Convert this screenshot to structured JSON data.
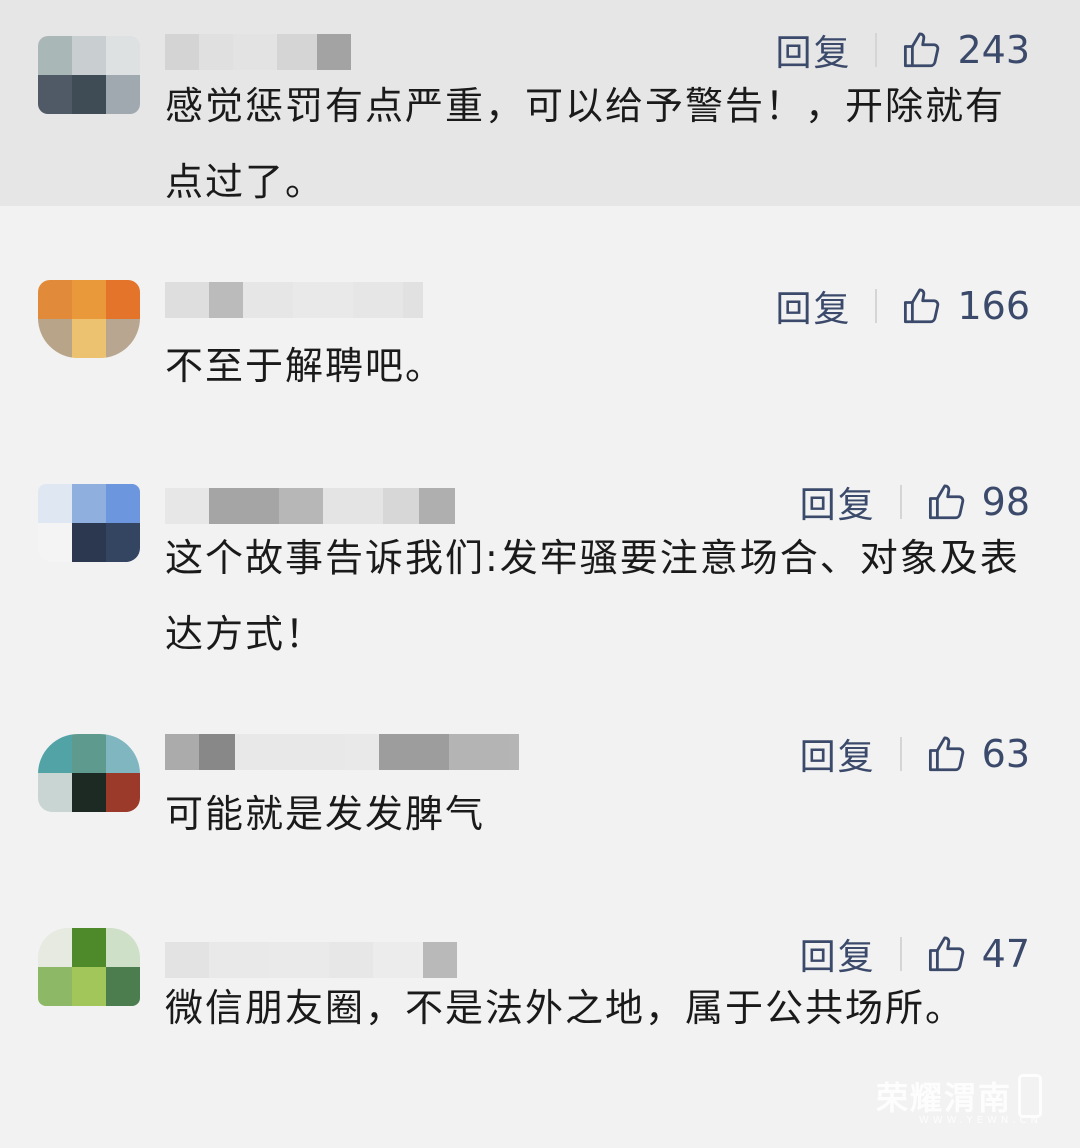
{
  "comments": [
    {
      "reply_label": "回复",
      "likes": "243",
      "text": "感觉惩罚有点严重，可以给予警告！，开除就有点过了。",
      "avatar_colors": [
        "#a9b8b6",
        "#c9cfd0",
        "#dde1e2",
        "#4f5a66",
        "#3f4b55",
        "#a1a9b0"
      ],
      "name_blocks": [
        "#cfcfcf",
        "#dedede",
        "#e3e3e3",
        "#d0d0d0",
        "#8d8d8d",
        "#e6e6e6"
      ]
    },
    {
      "reply_label": "回复",
      "likes": "166",
      "text": "不至于解聘吧。",
      "avatar_colors": [
        "#e08a3a",
        "#e9983a",
        "#e3742a",
        "#b8a489",
        "#ecc16f",
        "#b8a690"
      ],
      "name_blocks": [
        "#d8d8d8",
        "#a9a9a9",
        "#e3e3e3",
        "#e6e6e6",
        "#e2e2e2",
        "#dcdcdc"
      ]
    },
    {
      "reply_label": "回复",
      "likes": "98",
      "text": "这个故事告诉我们:发牢骚要注意场合、对象及表达方式！",
      "avatar_colors": [
        "#dfe7f3",
        "#8fb0df",
        "#6c96de",
        "#f4f4f4",
        "#2b3850",
        "#344562"
      ],
      "name_blocks": [
        "#e4e4e4",
        "#8c8c8c",
        "#a4a4a4",
        "#e0e0e0",
        "#cfcfcf",
        "#999999"
      ]
    },
    {
      "reply_label": "回复",
      "likes": "63",
      "text": "可能就是发发脾气",
      "avatar_colors": [
        "#52a3a6",
        "#5e9b8e",
        "#7fb6c0",
        "#c9d5d3",
        "#1d2a24",
        "#9b3a2a"
      ],
      "name_blocks": [
        "#9a9a9a",
        "#6e6e6e",
        "#e6e6e6",
        "#e8e8e8",
        "#888888",
        "#a5a5a5"
      ]
    },
    {
      "reply_label": "回复",
      "likes": "47",
      "text": "微信朋友圈，不是法外之地，属于公共场所。",
      "avatar_colors": [
        "#e6eae0",
        "#4f8a2a",
        "#cfe0c8",
        "#8db865",
        "#a3c65a",
        "#4b7d4f"
      ],
      "name_blocks": [
        "#dedede",
        "#e6e6e6",
        "#e8e8e8",
        "#e4e4e4",
        "#ebebeb",
        "#a7a7a7"
      ]
    }
  ],
  "watermark": {
    "main": "荣耀渭南",
    "sub": "WWW.YEWN.CN"
  },
  "colors": {
    "accent": "#3b4a6b",
    "text": "#1a1a1a",
    "background": "#f2f2f2",
    "highlight": "#e6e6e6"
  },
  "icons": {
    "like": "thumbs-up-icon"
  }
}
